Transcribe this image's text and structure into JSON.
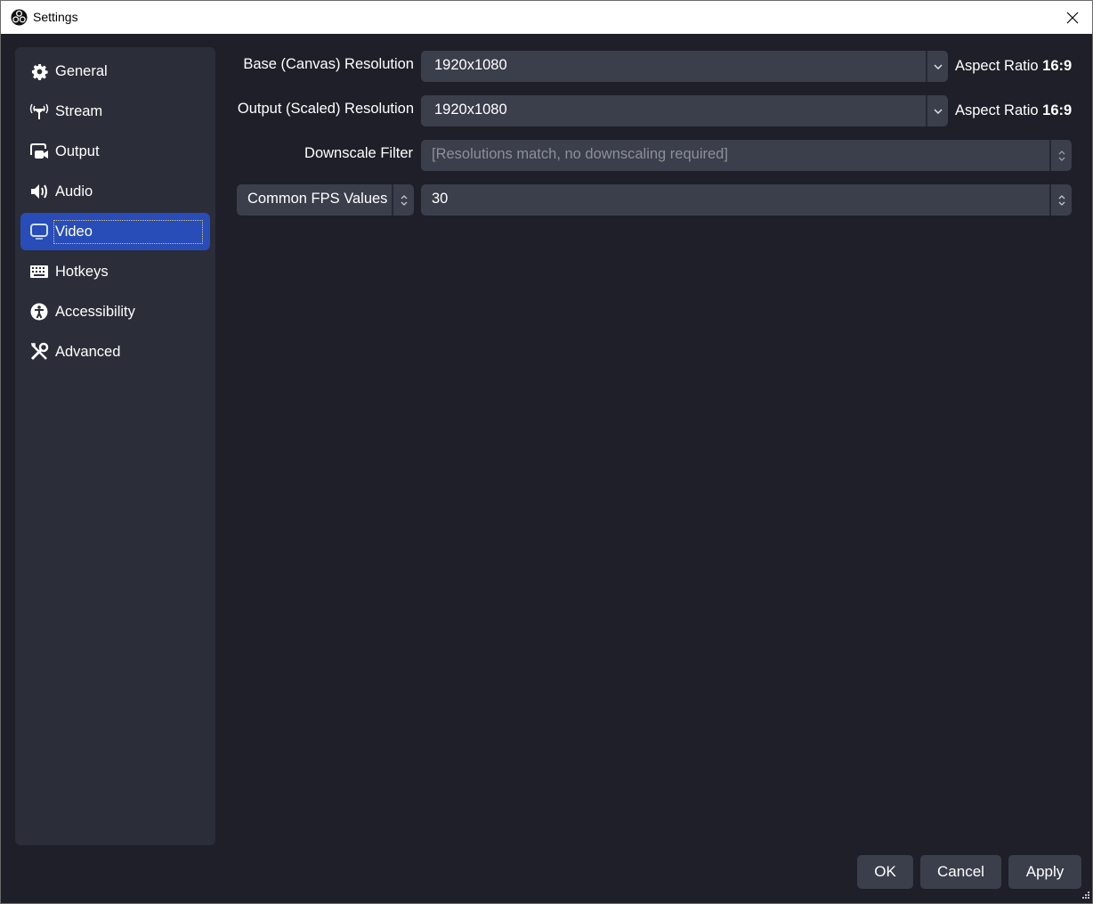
{
  "window": {
    "title": "Settings",
    "app_icon": "obs-logo-icon",
    "close_icon": "close-icon"
  },
  "sidebar": {
    "selected": "Video",
    "items": [
      {
        "label": "General",
        "icon": "gear-icon"
      },
      {
        "label": "Stream",
        "icon": "antenna-icon"
      },
      {
        "label": "Output",
        "icon": "output-camera-icon"
      },
      {
        "label": "Audio",
        "icon": "speaker-icon"
      },
      {
        "label": "Video",
        "icon": "monitor-icon"
      },
      {
        "label": "Hotkeys",
        "icon": "keyboard-icon"
      },
      {
        "label": "Accessibility",
        "icon": "accessibility-icon"
      },
      {
        "label": "Advanced",
        "icon": "tools-icon"
      }
    ]
  },
  "video": {
    "base_resolution": {
      "label": "Base (Canvas) Resolution",
      "value": "1920x1080",
      "aspect_prefix": "Aspect Ratio",
      "aspect_value": "16:9"
    },
    "output_resolution": {
      "label": "Output (Scaled) Resolution",
      "value": "1920x1080",
      "aspect_prefix": "Aspect Ratio",
      "aspect_value": "16:9"
    },
    "downscale_filter": {
      "label": "Downscale Filter",
      "value": "[Resolutions match, no downscaling required]"
    },
    "fps": {
      "type_label": "Common FPS Values",
      "value": "30"
    }
  },
  "buttons": {
    "ok": "OK",
    "cancel": "Cancel",
    "apply": "Apply"
  },
  "colors": {
    "background": "#1e1f28",
    "sidebar": "#2b2d38",
    "accent": "#284cb8",
    "control": "#3b3e4b"
  }
}
